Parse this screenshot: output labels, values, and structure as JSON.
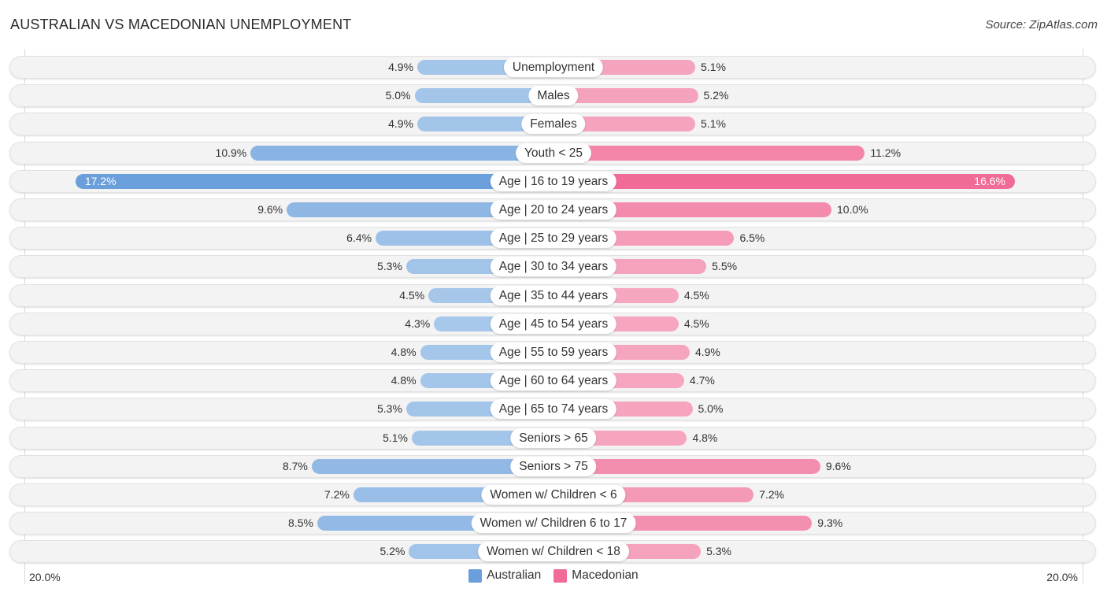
{
  "header": {
    "title": "AUSTRALIAN VS MACEDONIAN UNEMPLOYMENT",
    "source": "Source: ZipAtlas.com"
  },
  "colors": {
    "australian_strong": "#6a9fdb",
    "australian_light": "#a8c8eb",
    "macedonian_strong": "#f06b96",
    "macedonian_light": "#f6a9c1"
  },
  "chart_data": {
    "type": "bar",
    "orientation": "horizontal-diverging",
    "title": "AUSTRALIAN VS MACEDONIAN UNEMPLOYMENT",
    "xlabel": "",
    "ylabel": "",
    "unit": "%",
    "xlim": [
      -20.0,
      20.0
    ],
    "axis_labels": {
      "left": "20.0%",
      "right": "20.0%"
    },
    "grid": false,
    "legend_position": "bottom-center",
    "categories": [
      "Unemployment",
      "Males",
      "Females",
      "Youth < 25",
      "Age | 16 to 19 years",
      "Age | 20 to 24 years",
      "Age | 25 to 29 years",
      "Age | 30 to 34 years",
      "Age | 35 to 44 years",
      "Age | 45 to 54 years",
      "Age | 55 to 59 years",
      "Age | 60 to 64 years",
      "Age | 65 to 74 years",
      "Seniors > 65",
      "Seniors > 75",
      "Women w/ Children < 6",
      "Women w/ Children 6 to 17",
      "Women w/ Children < 18"
    ],
    "series": [
      {
        "name": "Australian",
        "side": "left",
        "values": [
          4.9,
          5.0,
          4.9,
          10.9,
          17.2,
          9.6,
          6.4,
          5.3,
          4.5,
          4.3,
          4.8,
          4.8,
          5.3,
          5.1,
          8.7,
          7.2,
          8.5,
          5.2
        ],
        "labels": [
          "4.9%",
          "5.0%",
          "4.9%",
          "10.9%",
          "17.2%",
          "9.6%",
          "6.4%",
          "5.3%",
          "4.5%",
          "4.3%",
          "4.8%",
          "4.8%",
          "5.3%",
          "5.1%",
          "8.7%",
          "7.2%",
          "8.5%",
          "5.2%"
        ]
      },
      {
        "name": "Macedonian",
        "side": "right",
        "values": [
          5.1,
          5.2,
          5.1,
          11.2,
          16.6,
          10.0,
          6.5,
          5.5,
          4.5,
          4.5,
          4.9,
          4.7,
          5.0,
          4.8,
          9.6,
          7.2,
          9.3,
          5.3
        ],
        "labels": [
          "5.1%",
          "5.2%",
          "5.1%",
          "11.2%",
          "16.6%",
          "10.0%",
          "6.5%",
          "5.5%",
          "4.5%",
          "4.5%",
          "4.9%",
          "4.7%",
          "5.0%",
          "4.8%",
          "9.6%",
          "7.2%",
          "9.3%",
          "5.3%"
        ]
      }
    ]
  },
  "legend": {
    "items": [
      {
        "label": "Australian"
      },
      {
        "label": "Macedonian"
      }
    ]
  }
}
